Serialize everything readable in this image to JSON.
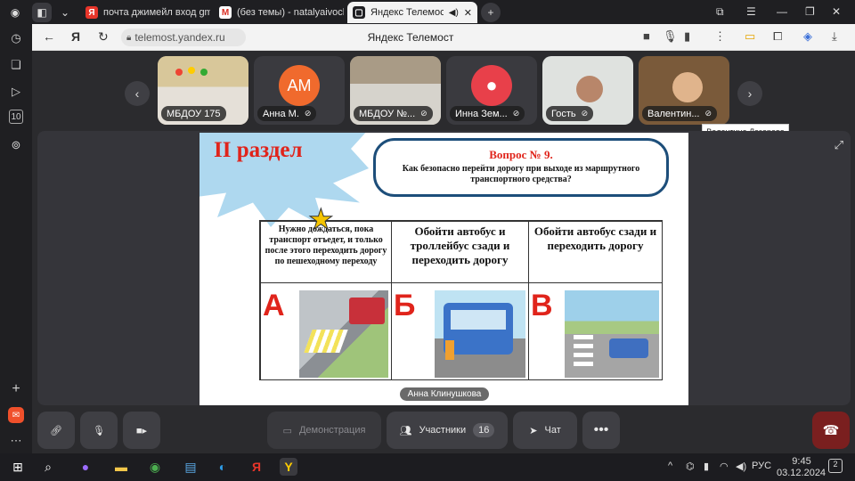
{
  "tabs": [
    {
      "label": "почта джимейл вход gma",
      "icon": "yandex-icon",
      "color": "#e8352a"
    },
    {
      "label": "(без темы) - natalyaivoch",
      "icon": "gmail-icon",
      "color": "#d93025"
    },
    {
      "label": "Яндекс Телемост",
      "icon": "telemost-icon",
      "color": "#1f1f22"
    }
  ],
  "address_bar": {
    "url": "telemost.yandex.ru",
    "title": "Яндекс Телемост"
  },
  "participants": [
    {
      "name": "МБДОУ 175",
      "type": "video"
    },
    {
      "name": "Анна М.",
      "type": "avatar",
      "initials": "АМ",
      "color": "#f06a2d"
    },
    {
      "name": "МБДОУ №...",
      "type": "video"
    },
    {
      "name": "Инна Зем...",
      "type": "avatar",
      "initials": "",
      "color": "#e8404a"
    },
    {
      "name": "Гость",
      "type": "video"
    },
    {
      "name": "Валентин...",
      "type": "video"
    }
  ],
  "tooltip": "Валентина Лазарева",
  "slide": {
    "section_title": "II раздел",
    "question_number": "Вопрос № 9.",
    "question_text": "Как безопасно перейти дорогу при выходе из маршрутного транспортного средства?",
    "options": [
      {
        "letter": "А",
        "text": "Нужно дождаться, пока транспорт отъедет, и только после этого переходить дорогу по пешеходному переходу"
      },
      {
        "letter": "Б",
        "text": "Обойти автобус и троллейбус сзади и переходить дорогу"
      },
      {
        "letter": "В",
        "text": "Обойти автобус сзади и переходить дорогу"
      }
    ]
  },
  "speaker_label": "Анна Клинушкова",
  "toolbar": {
    "demo_label": "Демонстрация",
    "participants_label": "Участники",
    "participants_count": "16",
    "chat_label": "Чат"
  },
  "taskbar": {
    "lang": "РУС",
    "time": "9:45",
    "date": "03.12.2024",
    "notifications": "2"
  },
  "colors": {
    "accent_red": "#e0241b",
    "end_call": "#7a1f1f"
  }
}
